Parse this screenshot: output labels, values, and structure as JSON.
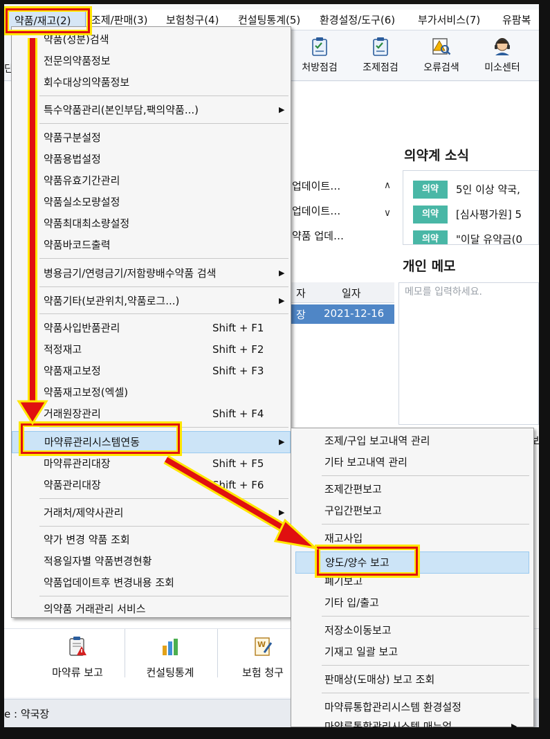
{
  "menubar": {
    "items": [
      {
        "label": "약품/재고(2)"
      },
      {
        "label": "조제/판매(3)"
      },
      {
        "label": "보험청구(4)"
      },
      {
        "label": "컨설팅통계(5)"
      },
      {
        "label": "환경설정/도구(6)"
      },
      {
        "label": "부가서비스(7)"
      },
      {
        "label": "유팜복"
      }
    ]
  },
  "toolbar": {
    "left_fragment": "딘",
    "buttons": [
      {
        "label": "처방점검",
        "icon": "clipboard-check-icon"
      },
      {
        "label": "조제점검",
        "icon": "clipboard-check-icon"
      },
      {
        "label": "오류검색",
        "icon": "warning-search-icon"
      },
      {
        "label": "미소센터",
        "icon": "headset-agent-icon"
      }
    ]
  },
  "main": {
    "news_title": "의약계 소식",
    "news_items": [
      {
        "badge": "의약",
        "text": "5인 이상 약국,"
      },
      {
        "badge": "의약",
        "text": "[심사평가원] 5"
      },
      {
        "badge": "의약",
        "text": "\"이달 유약금(0"
      }
    ],
    "updates": [
      {
        "text": "업데이트…"
      },
      {
        "text": "업데이트…"
      },
      {
        "text": "약품 업데…"
      }
    ],
    "memo_title": "개인 메모",
    "memo_placeholder": "메모를 입력하세요.",
    "grid": {
      "col1": "자",
      "col2": "일자",
      "row_col1": "장",
      "row_col2": "2021-12-16"
    },
    "right_fragments": {
      "report": "보",
      "upload": "업"
    }
  },
  "bottom_toolbar": {
    "buttons": [
      {
        "label": "마약류 보고",
        "icon": "clipboard-warning-icon"
      },
      {
        "label": "컨설팅통계",
        "icon": "bar-chart-icon"
      },
      {
        "label": "보험 청구",
        "icon": "document-edit-icon"
      }
    ]
  },
  "statusbar": {
    "text": "e : 약국장"
  },
  "main_menu": {
    "items": [
      {
        "label": "약품(성분)검색"
      },
      {
        "label": "전문의약품정보"
      },
      {
        "label": "회수대상의약품정보"
      },
      {
        "label": "특수약품관리(본인부담,팩의약품...)"
      },
      {
        "label": "약품구분설정"
      },
      {
        "label": "약품용법설정"
      },
      {
        "label": "약품유효기간관리"
      },
      {
        "label": "약품실소모량설정"
      },
      {
        "label": "약품최대최소량설정"
      },
      {
        "label": "약품바코드출력"
      },
      {
        "label": "병용금기/연령금기/저함량배수약품 검색"
      },
      {
        "label": "약품기타(보관위치,약품로그...)"
      },
      {
        "label": "약품사입반품관리",
        "shortcut": "Shift + F1"
      },
      {
        "label": "적정재고",
        "shortcut": "Shift + F2"
      },
      {
        "label": "약품재고보정",
        "shortcut": "Shift + F3"
      },
      {
        "label": "약품재고보정(엑셀)"
      },
      {
        "label": "거래원장관리",
        "shortcut": "Shift + F4"
      },
      {
        "label": "마약류관리시스템연동"
      },
      {
        "label": "마약류관리대장",
        "shortcut": "Shift + F5"
      },
      {
        "label": "약품관리대장",
        "shortcut": "Shift + F6"
      },
      {
        "label": "거래처/제약사관리"
      },
      {
        "label": "약가 변경 약품 조회"
      },
      {
        "label": "적용일자별 약품변경현황"
      },
      {
        "label": "약품업데이트후 변경내용 조회"
      },
      {
        "label": "의약품 거래관리 서비스"
      }
    ]
  },
  "sub_menu": {
    "items": [
      {
        "label": "조제/구입 보고내역 관리"
      },
      {
        "label": "기타 보고내역 관리"
      },
      {
        "label": "조제간편보고"
      },
      {
        "label": "구입간편보고"
      },
      {
        "label": "재고사입"
      },
      {
        "label": "양도/양수 보고"
      },
      {
        "label": "폐기보고"
      },
      {
        "label": "기타 입/출고"
      },
      {
        "label": "저장소이동보고"
      },
      {
        "label": "기재고 일괄 보고"
      },
      {
        "label": "판매상(도매상) 보고 조회"
      },
      {
        "label": "마약류통합관리시스템 환경설정"
      },
      {
        "label": "마약류통합관리시스템 매뉴얼"
      }
    ]
  },
  "colors": {
    "highlight": "#cce4f7",
    "annotation_red": "#e01010",
    "annotation_yellow": "#ffe600",
    "badge_teal": "#49b7a6",
    "grid_selected": "#4f86c6"
  }
}
